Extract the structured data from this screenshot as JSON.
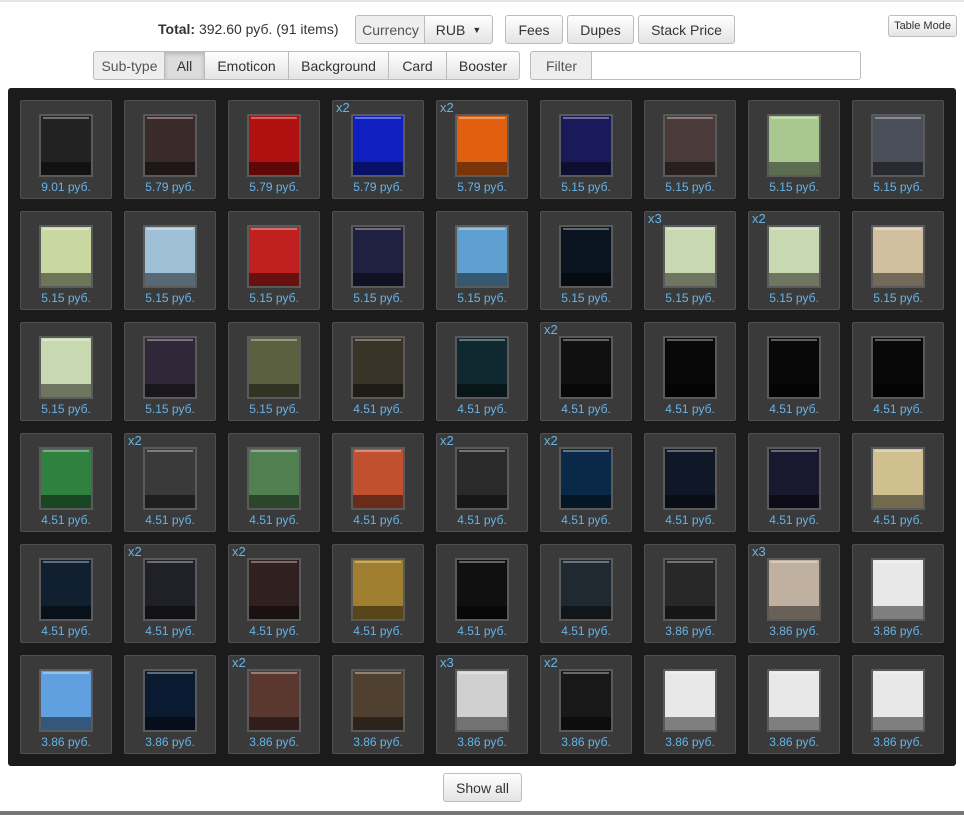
{
  "summary": {
    "total_label": "Total:",
    "total_text": " 392.60 руб. (91 items)"
  },
  "toolbar": {
    "currency_label": "Currency",
    "currency_value": "RUB",
    "fees": "Fees",
    "dupes": "Dupes",
    "stack_price": "Stack Price",
    "table_mode": "Table Mode"
  },
  "filters": {
    "subtype_label": "Sub-type",
    "subtypes": [
      "All",
      "Emoticon",
      "Background",
      "Card",
      "Booster"
    ],
    "active_subtype": "All",
    "filter_label": "Filter",
    "filter_value": ""
  },
  "colors": {
    "price": "#66b3e6",
    "grid_bg": "#1b1b1b",
    "card_bg": "#3a3a3a"
  },
  "items": [
    {
      "price": "9.01 руб.",
      "qty": "",
      "bg": "#222222"
    },
    {
      "price": "5.79 руб.",
      "qty": "",
      "bg": "#3a2a2a"
    },
    {
      "price": "5.79 руб.",
      "qty": "",
      "bg": "#b01010"
    },
    {
      "price": "5.79 руб.",
      "qty": "x2",
      "bg": "#1020c0"
    },
    {
      "price": "5.79 руб.",
      "qty": "x2",
      "bg": "#e06010"
    },
    {
      "price": "5.15 руб.",
      "qty": "",
      "bg": "#1a1a5a"
    },
    {
      "price": "5.15 руб.",
      "qty": "",
      "bg": "#4a3a3a"
    },
    {
      "price": "5.15 руб.",
      "qty": "",
      "bg": "#a8c890"
    },
    {
      "price": "5.15 руб.",
      "qty": "",
      "bg": "#4a4e58"
    },
    {
      "price": "5.15 руб.",
      "qty": "",
      "bg": "#c8d8a0"
    },
    {
      "price": "5.15 руб.",
      "qty": "",
      "bg": "#a0c0d8"
    },
    {
      "price": "5.15 руб.",
      "qty": "",
      "bg": "#c02020"
    },
    {
      "price": "5.15 руб.",
      "qty": "",
      "bg": "#202040"
    },
    {
      "price": "5.15 руб.",
      "qty": "",
      "bg": "#60a0d0"
    },
    {
      "price": "5.15 руб.",
      "qty": "",
      "bg": "#0a1420"
    },
    {
      "price": "5.15 руб.",
      "qty": "x3",
      "bg": "#c8d8b0"
    },
    {
      "price": "5.15 руб.",
      "qty": "x2",
      "bg": "#c8d8b0"
    },
    {
      "price": "5.15 руб.",
      "qty": "",
      "bg": "#d0c0a0"
    },
    {
      "price": "5.15 руб.",
      "qty": "",
      "bg": "#c8d8b0"
    },
    {
      "price": "5.15 руб.",
      "qty": "",
      "bg": "#302838"
    },
    {
      "price": "5.15 руб.",
      "qty": "",
      "bg": "#5a6040"
    },
    {
      "price": "4.51 руб.",
      "qty": "",
      "bg": "#3a3428"
    },
    {
      "price": "4.51 руб.",
      "qty": "",
      "bg": "#102830"
    },
    {
      "price": "4.51 руб.",
      "qty": "x2",
      "bg": "#101010"
    },
    {
      "price": "4.51 руб.",
      "qty": "",
      "bg": "#080808"
    },
    {
      "price": "4.51 руб.",
      "qty": "",
      "bg": "#080808"
    },
    {
      "price": "4.51 руб.",
      "qty": "",
      "bg": "#080808"
    },
    {
      "price": "4.51 руб.",
      "qty": "",
      "bg": "#308040"
    },
    {
      "price": "4.51 руб.",
      "qty": "x2",
      "bg": "#3a3a3a"
    },
    {
      "price": "4.51 руб.",
      "qty": "",
      "bg": "#508050"
    },
    {
      "price": "4.51 руб.",
      "qty": "",
      "bg": "#c05030"
    },
    {
      "price": "4.51 руб.",
      "qty": "x2",
      "bg": "#2a2a2a"
    },
    {
      "price": "4.51 руб.",
      "qty": "x2",
      "bg": "#0a2848"
    },
    {
      "price": "4.51 руб.",
      "qty": "",
      "bg": "#101828"
    },
    {
      "price": "4.51 руб.",
      "qty": "",
      "bg": "#181830"
    },
    {
      "price": "4.51 руб.",
      "qty": "",
      "bg": "#d0c090"
    },
    {
      "price": "4.51 руб.",
      "qty": "",
      "bg": "#102030"
    },
    {
      "price": "4.51 руб.",
      "qty": "x2",
      "bg": "#202028"
    },
    {
      "price": "4.51 руб.",
      "qty": "x2",
      "bg": "#302020"
    },
    {
      "price": "4.51 руб.",
      "qty": "",
      "bg": "#a08030"
    },
    {
      "price": "4.51 руб.",
      "qty": "",
      "bg": "#101010"
    },
    {
      "price": "4.51 руб.",
      "qty": "",
      "bg": "#202830"
    },
    {
      "price": "3.86 руб.",
      "qty": "",
      "bg": "#282828"
    },
    {
      "price": "3.86 руб.",
      "qty": "x3",
      "bg": "#c0b0a0"
    },
    {
      "price": "3.86 руб.",
      "qty": "",
      "bg": "#e8e8e8"
    },
    {
      "price": "3.86 руб.",
      "qty": "",
      "bg": "#60a0e0"
    },
    {
      "price": "3.86 руб.",
      "qty": "",
      "bg": "#0a1a30"
    },
    {
      "price": "3.86 руб.",
      "qty": "x2",
      "bg": "#5a3830"
    },
    {
      "price": "3.86 руб.",
      "qty": "",
      "bg": "#504030"
    },
    {
      "price": "3.86 руб.",
      "qty": "x3",
      "bg": "#d0d0d0"
    },
    {
      "price": "3.86 руб.",
      "qty": "x2",
      "bg": "#181818"
    },
    {
      "price": "3.86 руб.",
      "qty": "",
      "bg": "#e8e8e8"
    },
    {
      "price": "3.86 руб.",
      "qty": "",
      "bg": "#e8e8e8"
    },
    {
      "price": "3.86 руб.",
      "qty": "",
      "bg": "#e8e8e8"
    }
  ],
  "footer": {
    "show_all": "Show all"
  }
}
